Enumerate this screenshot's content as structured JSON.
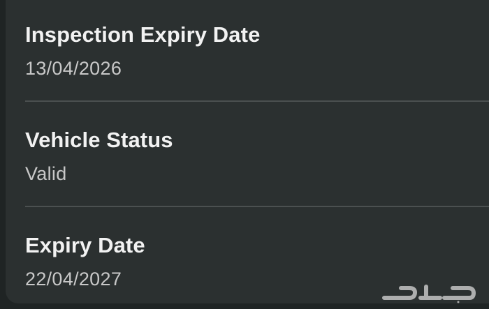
{
  "details": {
    "items": [
      {
        "label": "Inspection Expiry Date",
        "value": "13/04/2026"
      },
      {
        "label": "Vehicle Status",
        "value": "Valid"
      },
      {
        "label": "Expiry Date",
        "value": "22/04/2027"
      }
    ]
  },
  "watermark": {
    "text": "حراج"
  },
  "colors": {
    "background": "#1f2424",
    "card": "#2b3030",
    "label": "#f2f2f2",
    "value": "#c8c8c8",
    "divider": "#4b5050"
  }
}
